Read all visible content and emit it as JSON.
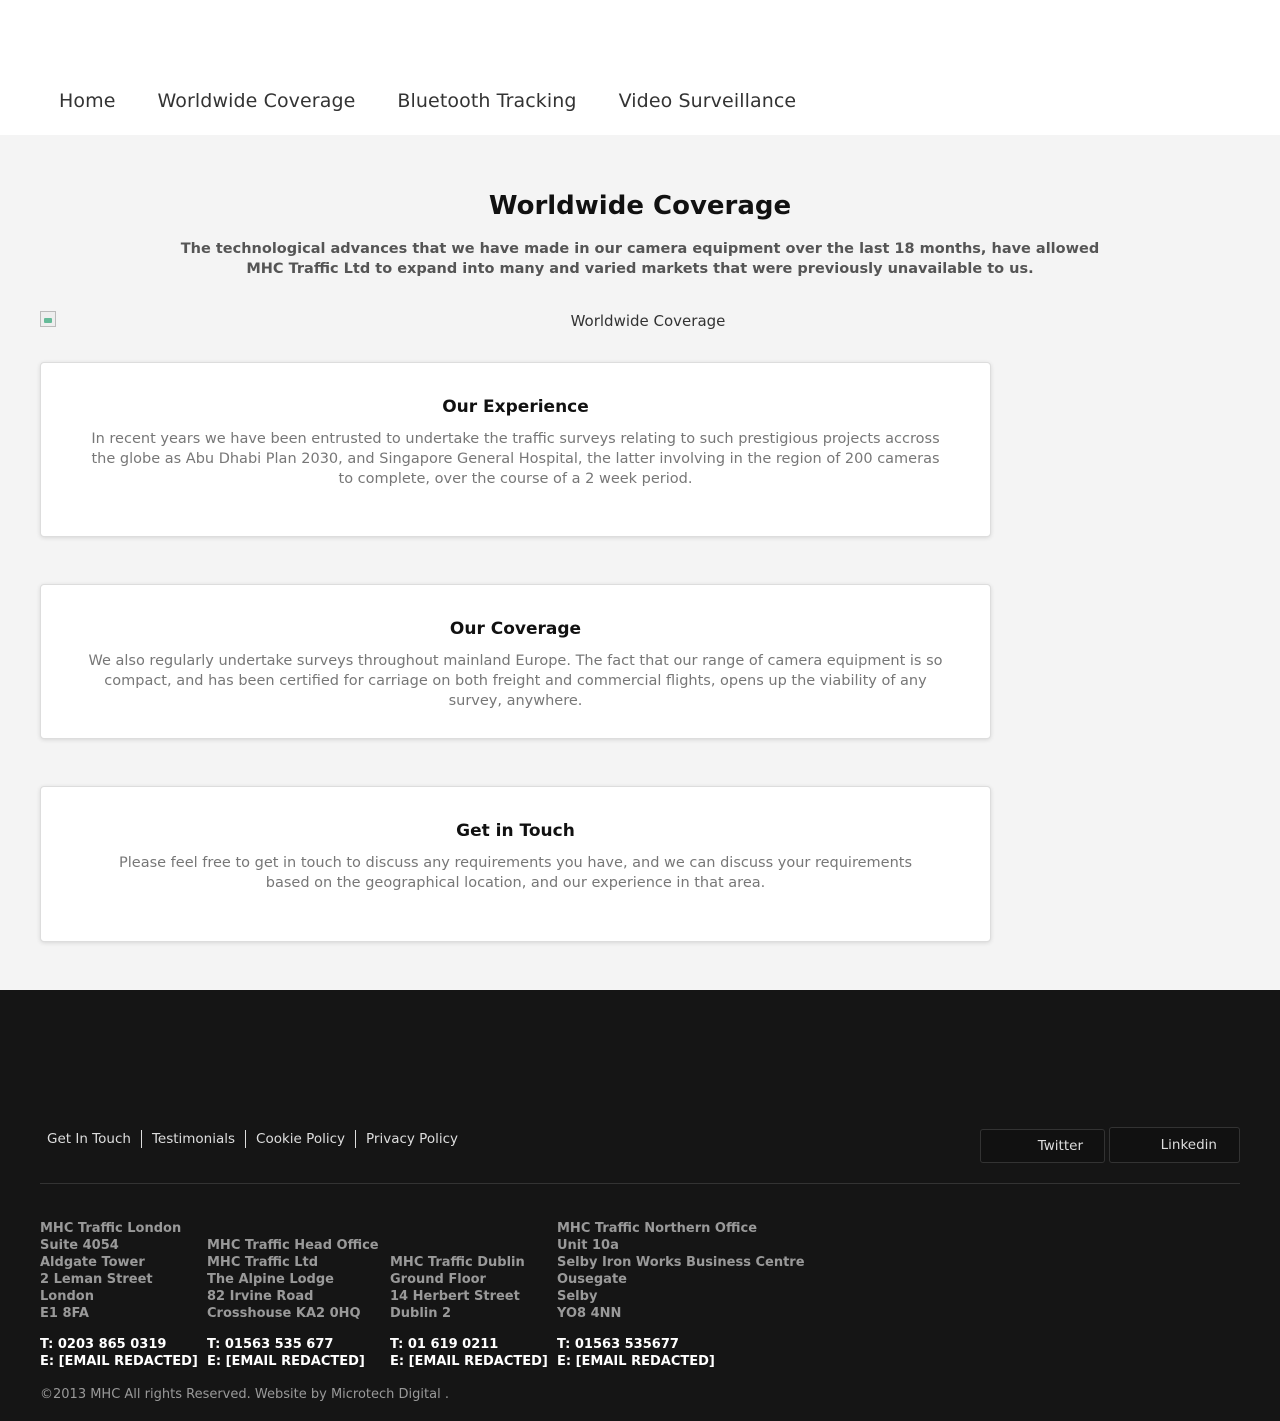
{
  "nav": {
    "items": [
      {
        "label": "Home"
      },
      {
        "label": "Worldwide Coverage"
      },
      {
        "label": "Bluetooth Tracking"
      },
      {
        "label": "Video Surveillance"
      }
    ]
  },
  "hero": {
    "title": "Worldwide Coverage",
    "intro": "The technological advances that we have made in our camera equipment over the last 18 months, have allowed MHC Traffic Ltd to expand into many and varied markets that were previously unavailable to us.",
    "image_alt": "Worldwide Coverage"
  },
  "cards": [
    {
      "title": "Our Experience",
      "text": "In recent years we have been entrusted to undertake the traffic surveys relating to such prestigious projects accross the globe as Abu Dhabi Plan 2030, and Singapore General Hospital, the latter involving in the region of 200 cameras to complete, over the course of a 2 week period."
    },
    {
      "title": "Our Coverage",
      "text": "We also regularly undertake surveys throughout mainland Europe. The fact that our range of camera equipment is so compact, and has been certified for carriage on both freight and commercial flights, opens up the viability of any survey, anywhere."
    },
    {
      "title": "Get in Touch",
      "text": "Please feel free to get in touch to discuss any requirements you have, and we can discuss your requirements based on the geographical location, and our experience in that area."
    }
  ],
  "footer": {
    "links": [
      {
        "label": "Get In Touch"
      },
      {
        "label": "Testimonials"
      },
      {
        "label": "Cookie Policy"
      },
      {
        "label": "Privacy Policy"
      }
    ],
    "social": {
      "twitter": "Twitter",
      "linkedin": "Linkedin"
    },
    "offices": [
      {
        "lines": [
          "MHC Traffic London",
          "Suite 4054",
          "Aldgate Tower",
          "2 Leman Street",
          "London",
          "E1 8FA"
        ],
        "phone": "T: 0203 865 0319",
        "email": "E: [EMAIL REDACTED]"
      },
      {
        "lines": [
          "MHC Traffic Head Office",
          "MHC Traffic Ltd",
          "The Alpine Lodge",
          "82 Irvine Road",
          "Crosshouse KA2 0HQ"
        ],
        "phone": "T: 01563 535 677",
        "email": "E: [EMAIL REDACTED]"
      },
      {
        "lines": [
          "MHC Traffic Dublin",
          "Ground Floor",
          "14 Herbert Street",
          "Dublin 2"
        ],
        "phone": "T: 01 619 0211",
        "email": "E: [EMAIL REDACTED]"
      },
      {
        "lines": [
          "MHC Traffic Northern Office",
          "Unit 10a",
          "Selby Iron Works Business Centre",
          "Ousegate",
          "Selby",
          "YO8 4NN"
        ],
        "phone": "T: 01563 535677",
        "email": "E: [EMAIL REDACTED]"
      }
    ],
    "copyright": "©2013 MHC All rights Reserved. Website by",
    "credit_link": "Microtech Digital",
    "credit_suffix": " ."
  }
}
